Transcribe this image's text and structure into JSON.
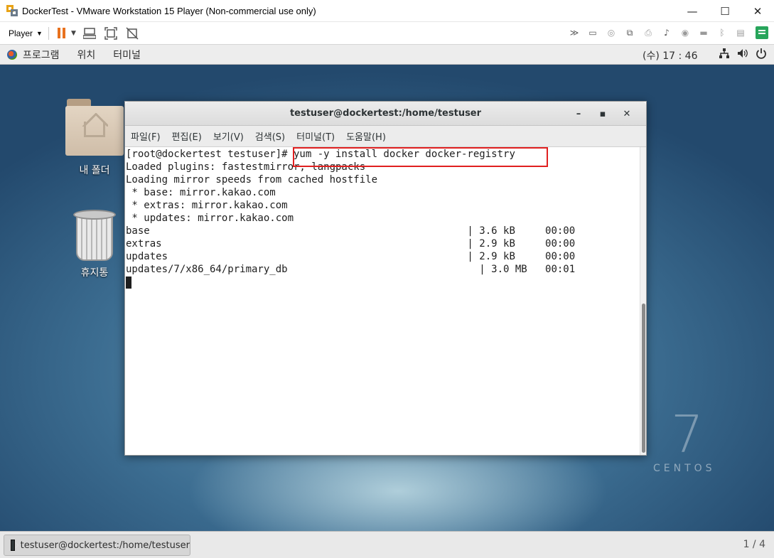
{
  "vm_window": {
    "title": "DockerTest - VMware Workstation 15 Player (Non-commercial use only)",
    "controls": [
      "—",
      "☐",
      "✕"
    ]
  },
  "vm_toolbar": {
    "player_label": "Player"
  },
  "gnome_bar": {
    "menus": [
      "프로그램",
      "위치",
      "터미널"
    ],
    "clock": "(수) 17 : 46"
  },
  "desktop": {
    "icons": [
      {
        "label": "내 폴더",
        "icon": "home-folder-icon"
      },
      {
        "label": "휴지통",
        "icon": "trash-icon"
      }
    ],
    "brand_number": "7",
    "brand_text": "CENTOS"
  },
  "terminal": {
    "title": "testuser@dockertest:/home/testuser",
    "controls": [
      "–",
      "▪",
      "✕"
    ],
    "menu": [
      "파일(F)",
      "편집(E)",
      "보기(V)",
      "검색(S)",
      "터미널(T)",
      "도움말(H)"
    ],
    "lines": [
      "[root@dockertest testuser]# yum -y install docker docker-registry",
      "Loaded plugins: fastestmirror, langpacks",
      "Loading mirror speeds from cached hostfile",
      " * base: mirror.kakao.com",
      " * extras: mirror.kakao.com",
      " * updates: mirror.kakao.com",
      "base                                                     | 3.6 kB     00:00",
      "extras                                                   | 2.9 kB     00:00",
      "updates                                                  | 2.9 kB     00:00",
      "updates/7/x86_64/primary_db                                | 3.0 MB   00:01"
    ]
  },
  "taskbar": {
    "task_label": "testuser@dockertest:/home/testuser",
    "workspace": "1 / 4"
  },
  "colors": {
    "highlight": "#e02020",
    "pause_accent": "#e8711e"
  }
}
